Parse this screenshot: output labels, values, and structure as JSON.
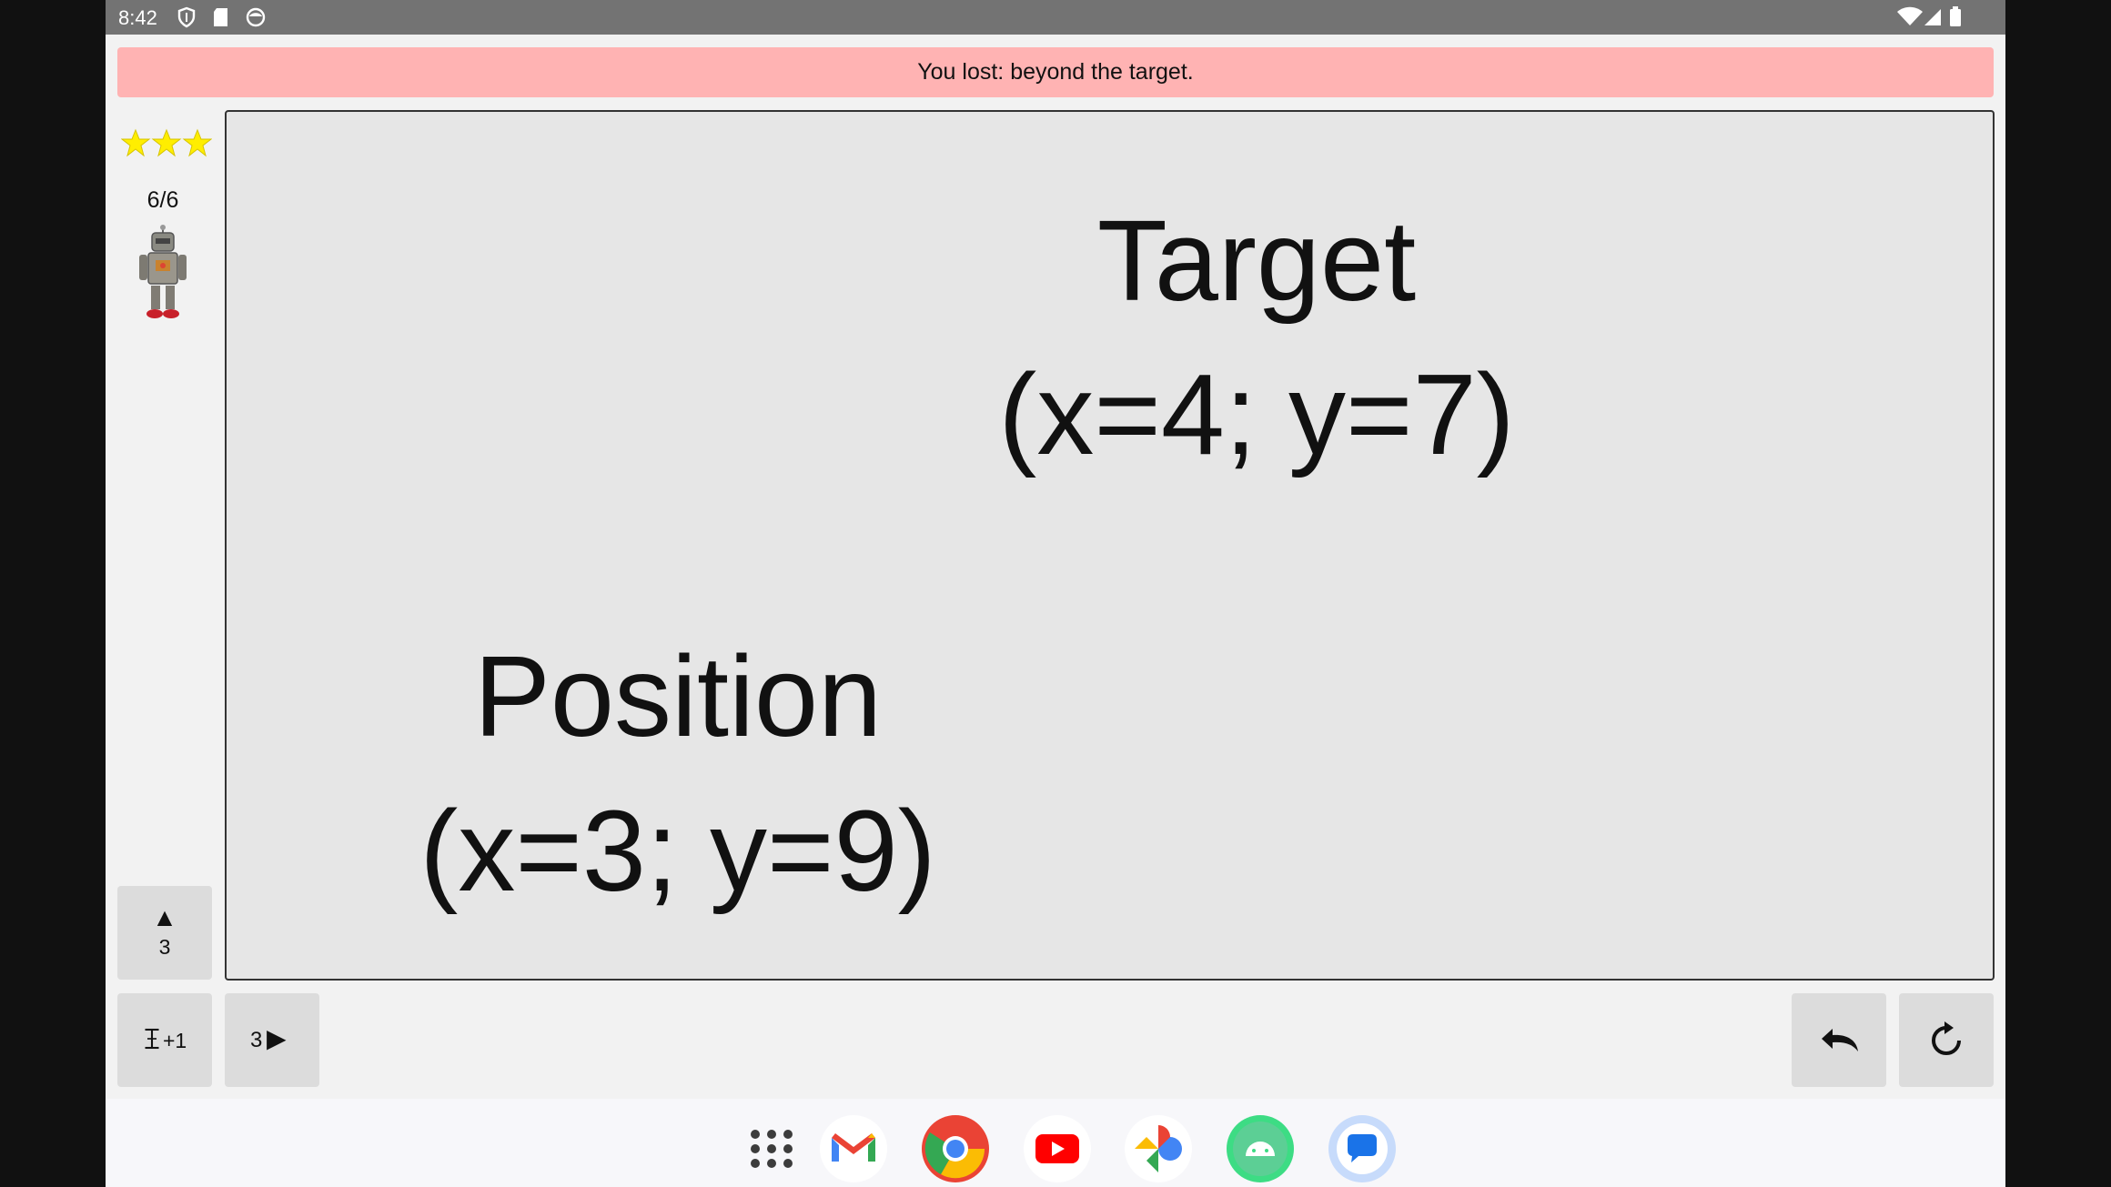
{
  "status_bar": {
    "time": "8:42",
    "left_icons": [
      "shield-icon",
      "sd-card-icon",
      "face-icon"
    ],
    "right_icons": [
      "wifi-icon",
      "signal-icon",
      "battery-icon"
    ]
  },
  "banner": {
    "message": "You lost: beyond the target.",
    "color": "#ffb3b3"
  },
  "sidebar": {
    "stars": 3,
    "star_color": "#ffee00",
    "level": "6/6",
    "character": "robot-icon"
  },
  "board": {
    "target_title": "Target",
    "target_coords": "(x=4; y=7)",
    "position_title": "Position",
    "position_coords": "(x=3; y=9)"
  },
  "controls": {
    "up_arrow": "▲",
    "up_value": "3",
    "increment_label": "+1",
    "forward_value": "3",
    "forward_arrow": "▶"
  },
  "dock": {
    "apps": [
      "apps-grid-icon",
      "gmail-icon",
      "chrome-icon",
      "youtube-icon",
      "photos-icon",
      "android-icon",
      "messages-icon"
    ]
  }
}
